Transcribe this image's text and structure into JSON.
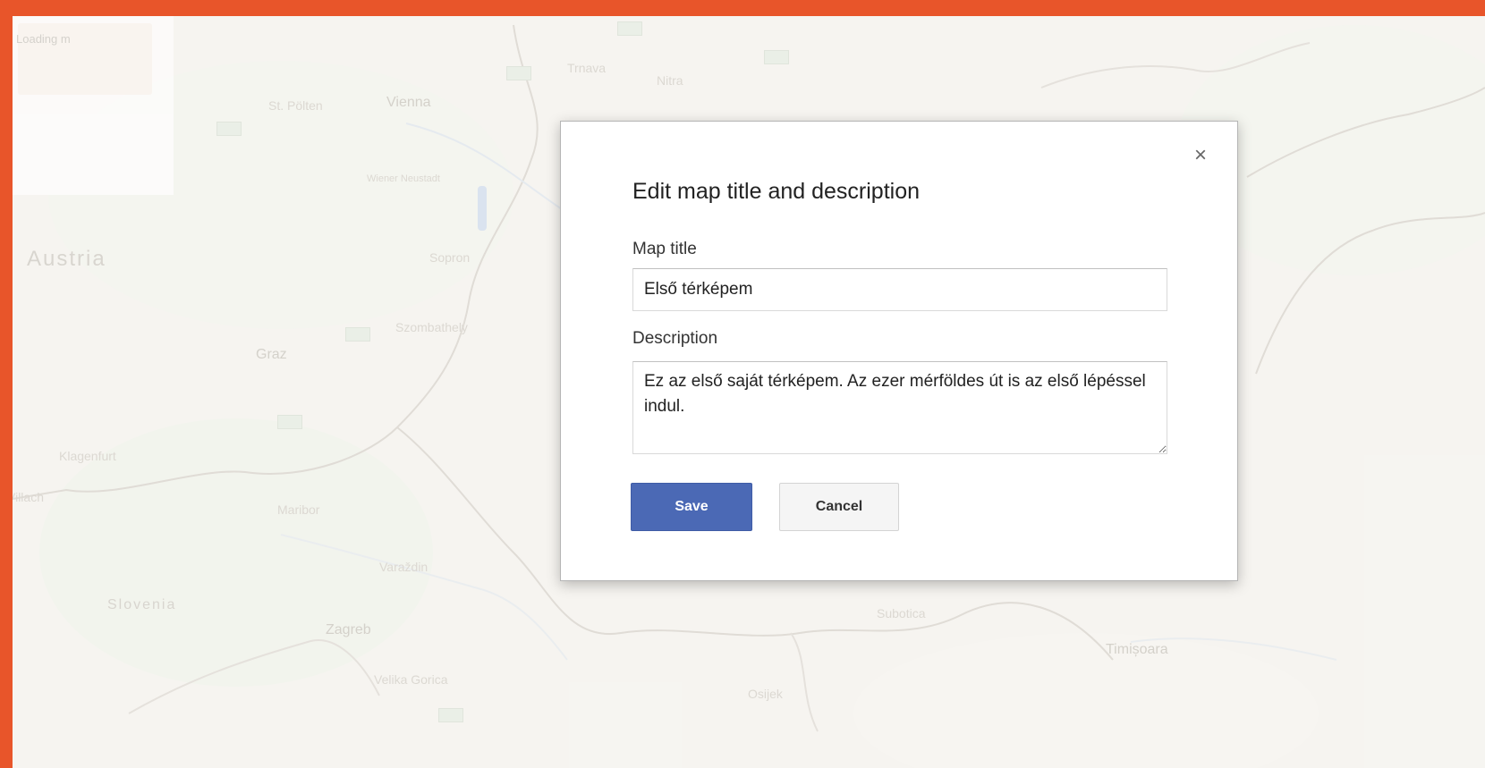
{
  "map": {
    "loading_text": "Loading m",
    "places": {
      "austria": "Austria",
      "vienna": "Vienna",
      "st_polten": "St. Pölten",
      "graz": "Graz",
      "klagenfurt": "Klagenfurt",
      "villach": "Villach",
      "maribor": "Maribor",
      "slovenia": "Slovenia",
      "zagreb": "Zagreb",
      "varazdin": "Varaždin",
      "szombathely": "Szombathely",
      "sopron": "Sopron",
      "wiener_neustadt": "Wiener Neustadt",
      "trnava": "Trnava",
      "nitra": "Nitra",
      "subotica": "Subotica",
      "timisoara": "Timișoara",
      "osijek": "Osijek",
      "velika_gorica": "Velika Gorica"
    }
  },
  "dialog": {
    "title": "Edit map title and description",
    "close_symbol": "×",
    "map_title_label": "Map title",
    "map_title_value": "Első térképem",
    "description_label": "Description",
    "description_value": "Ez az első saját térképem. Az ezer mérföldes út is az első lépéssel indul.",
    "save_label": "Save",
    "cancel_label": "Cancel"
  },
  "colors": {
    "frame_border": "#e8552a",
    "save_button": "#4b69b5",
    "map_background": "#f1efe9"
  }
}
